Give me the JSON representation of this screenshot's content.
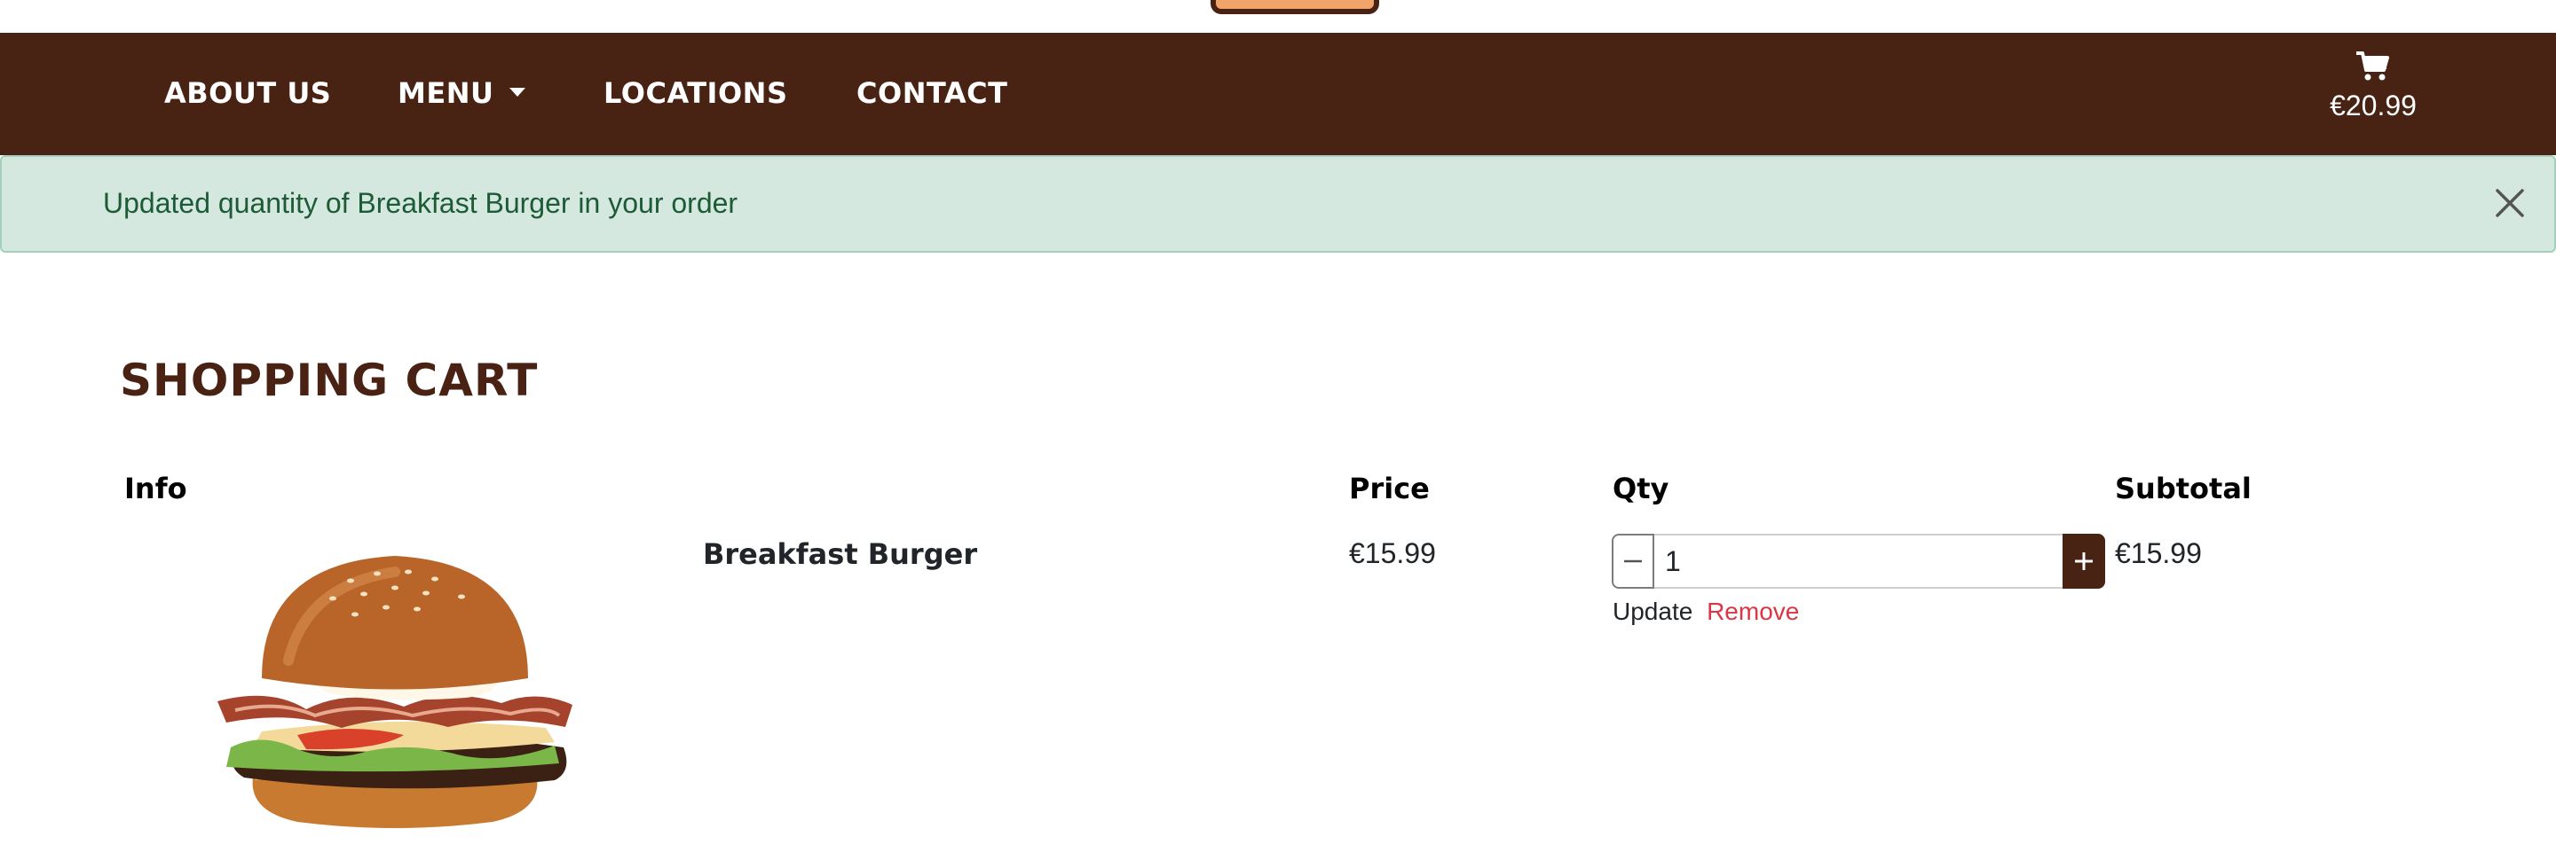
{
  "nav": {
    "items": [
      {
        "label": "ABOUT US"
      },
      {
        "label": "MENU"
      },
      {
        "label": "LOCATIONS"
      },
      {
        "label": "CONTACT"
      }
    ],
    "cart_total": "€20.99"
  },
  "alert": {
    "message": "Updated quantity of Breakfast Burger in your order"
  },
  "page": {
    "title": "SHOPPING CART"
  },
  "table": {
    "headers": {
      "info": "Info",
      "price": "Price",
      "qty": "Qty",
      "subtotal": "Subtotal"
    },
    "rows": [
      {
        "name": "Breakfast Burger",
        "price": "€15.99",
        "quantity": "1",
        "subtotal": "€15.99",
        "update_label": "Update",
        "remove_label": "Remove"
      }
    ]
  },
  "colors": {
    "navbar": "#482213",
    "accent": "#4a2213",
    "alert_bg": "#d4e8df",
    "alert_text": "#1d5a36",
    "remove_link": "#dc3545"
  },
  "icons": {
    "cart": "shopping-cart-icon",
    "close": "close-icon",
    "minus": "minus-icon",
    "plus": "plus-icon",
    "caret": "caret-down-icon"
  }
}
